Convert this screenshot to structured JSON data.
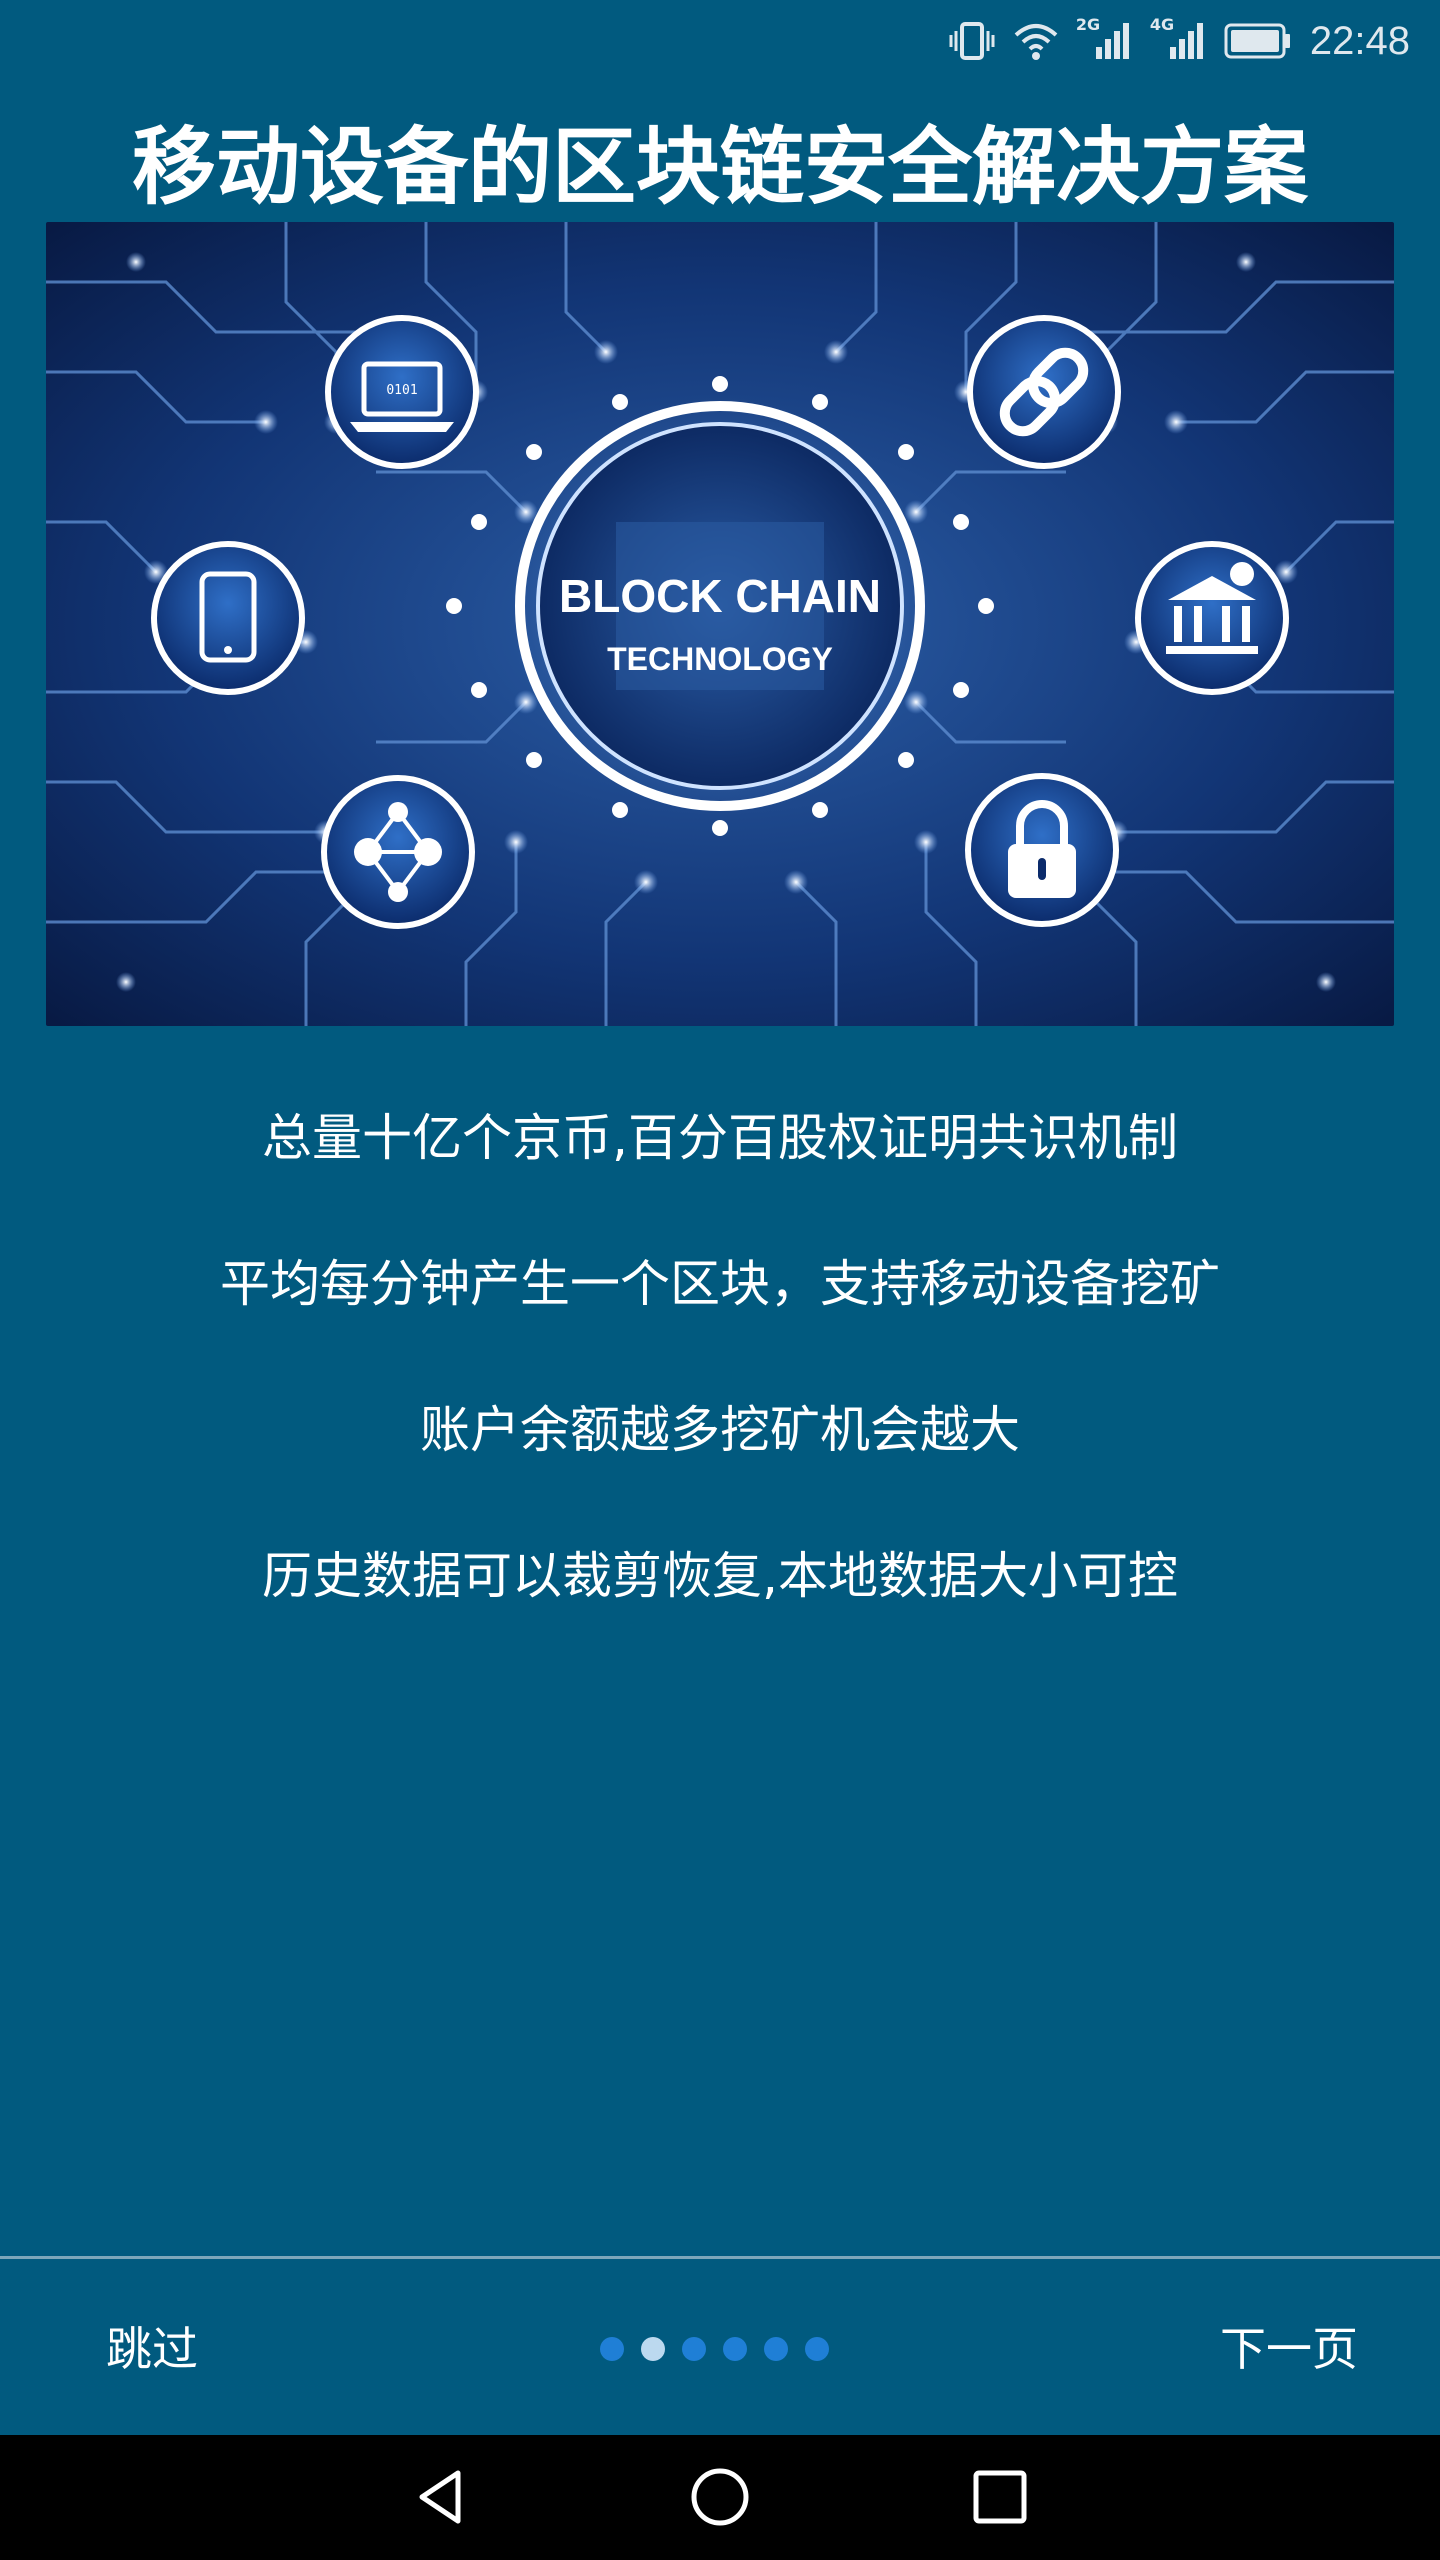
{
  "status_bar": {
    "time": "22:48",
    "network_1": "2G",
    "network_2": "4G",
    "icons": [
      "vibrate-icon",
      "wifi-icon",
      "signal-2g-icon",
      "signal-4g-icon",
      "battery-icon"
    ]
  },
  "title": "移动设备的区块链安全解决方案",
  "hero": {
    "center_line1": "BLOCK CHAIN",
    "center_line2": "TECHNOLOGY",
    "icons": [
      "laptop-icon",
      "tablet-icon",
      "bitcoin-network-icon",
      "link-icon",
      "bank-icon",
      "lock-icon"
    ]
  },
  "features": [
    "总量十亿个京币,百分百股权证明共识机制",
    "平均每分钟产生一个区块，支持移动设备挖矿",
    "账户余额越多挖矿机会越大",
    "历史数据可以裁剪恢复,本地数据大小可控"
  ],
  "bottom_nav": {
    "skip_label": "跳过",
    "next_label": "下一页",
    "page_count": 6,
    "current_page": 2
  },
  "android_nav": {
    "icons": [
      "back-icon",
      "home-icon",
      "recents-icon"
    ]
  },
  "colors": {
    "background": "#015a7f",
    "dot": "#1f7fd6",
    "dot_active": "#bcd9ef"
  }
}
